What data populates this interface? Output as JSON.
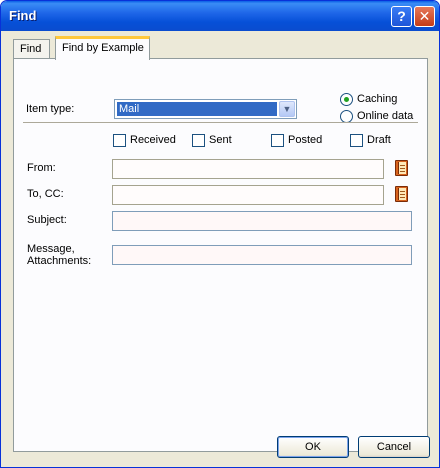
{
  "window": {
    "title": "Find"
  },
  "caption_buttons": {
    "help": "?",
    "close": "✕"
  },
  "tabs": [
    {
      "label": "Find"
    },
    {
      "label": "Find by Example"
    }
  ],
  "item_type": {
    "label": "Item type:",
    "value": "Mail"
  },
  "source": {
    "options": [
      {
        "label": "Caching",
        "checked": true
      },
      {
        "label": "Online data",
        "checked": false
      }
    ]
  },
  "categories": [
    {
      "label": "Received",
      "checked": false
    },
    {
      "label": "Sent",
      "checked": false
    },
    {
      "label": "Posted",
      "checked": false
    },
    {
      "label": "Draft",
      "checked": false
    }
  ],
  "fields": {
    "from_label": "From:",
    "from_value": "",
    "to_cc_label": "To, CC:",
    "to_cc_value": "",
    "subject_label": "Subject:",
    "subject_value": "",
    "message_label_1": "Message,",
    "message_label_2": "Attachments:",
    "message_value": ""
  },
  "buttons": {
    "ok": "OK",
    "cancel": "Cancel"
  },
  "icons": [
    "help-icon",
    "close-icon",
    "chevron-down-icon",
    "address-book-icon"
  ]
}
